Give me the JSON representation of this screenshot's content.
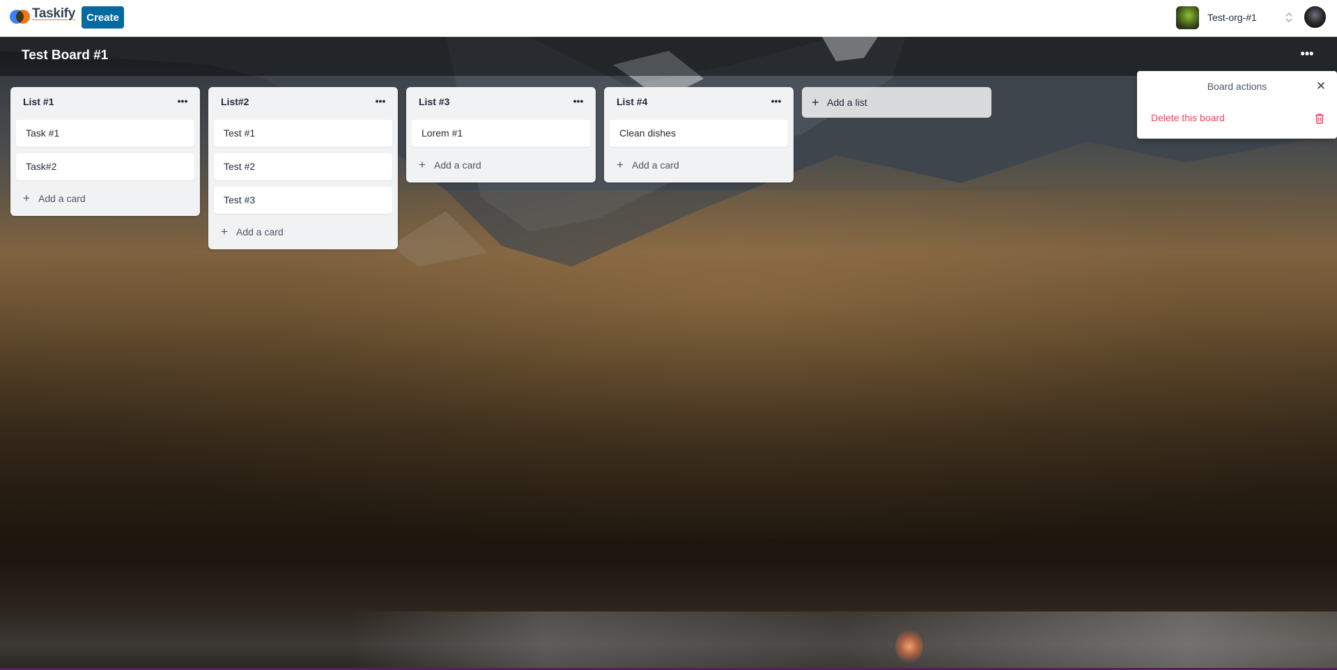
{
  "navbar": {
    "logo_text": "Taskify",
    "create_label": "Create",
    "org_name": "Test-org-#1",
    "org_chevron": "⌃⌄"
  },
  "board": {
    "title": "Test Board #1",
    "more_label": "•••"
  },
  "lists": [
    {
      "title": "List #1",
      "cards": [
        "Task #1",
        "Task#2"
      ],
      "add_card_label": "Add a card"
    },
    {
      "title": "List#2",
      "cards": [
        "Test #1",
        "Test #2",
        "Test #3"
      ],
      "add_card_label": "Add a card"
    },
    {
      "title": "List #3",
      "cards": [
        "Lorem #1"
      ],
      "add_card_label": "Add a card"
    },
    {
      "title": "List #4",
      "cards": [
        "Clean dishes"
      ],
      "add_card_label": "Add a card"
    }
  ],
  "add_list_label": "Add a list",
  "popover": {
    "title": "Board actions",
    "close_glyph": "✕",
    "delete_label": "Delete this board"
  },
  "glyphs": {
    "more": "•••",
    "plus": "+"
  },
  "colors": {
    "brand": "#0369a1",
    "danger": "#f43f5e",
    "list_bg": "#f1f2f4"
  },
  "icons": [
    "logo-icon",
    "more-icon",
    "plus-icon",
    "close-icon",
    "trash-icon",
    "chevron-updown-icon"
  ]
}
